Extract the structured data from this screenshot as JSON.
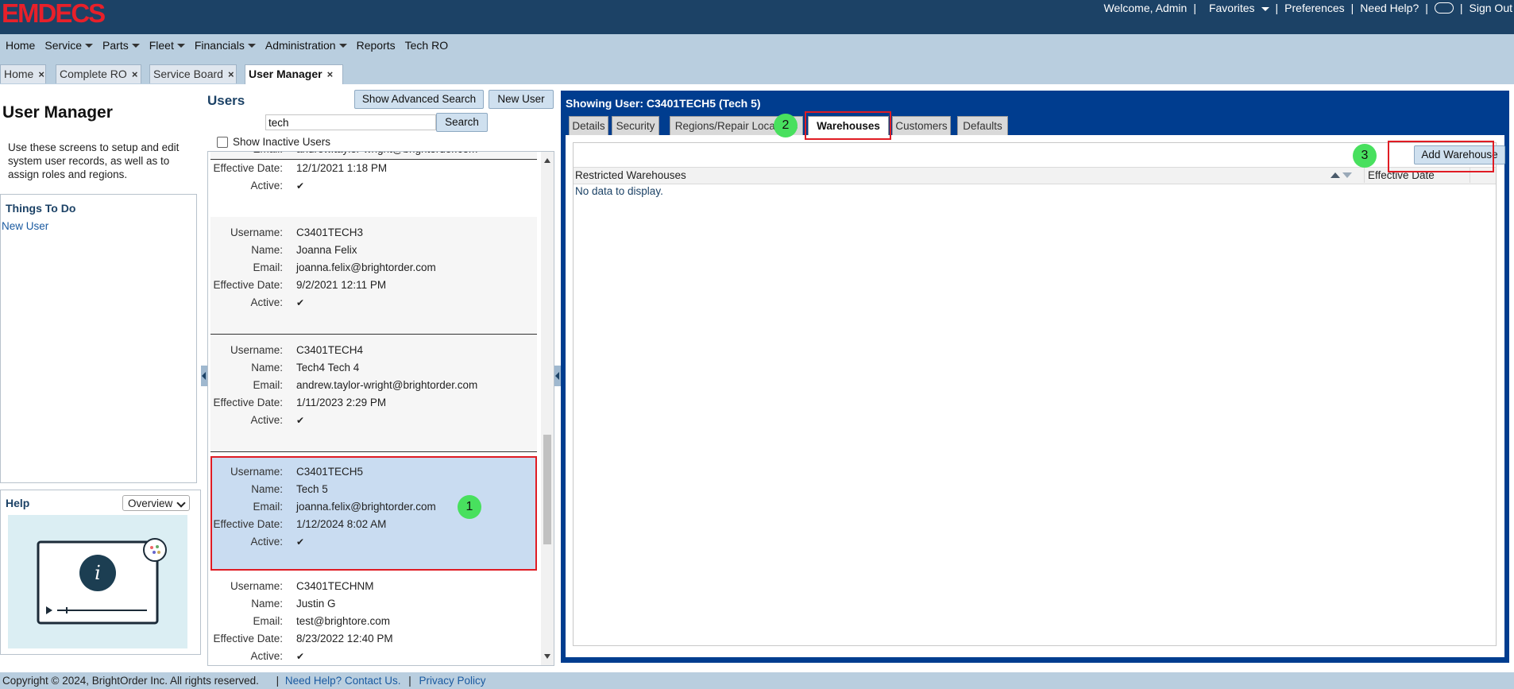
{
  "app": {
    "logo": "EMDECS"
  },
  "topbar": {
    "welcome": "Welcome, Admin",
    "favorites": "Favorites",
    "preferences": "Preferences",
    "need_help": "Need Help?",
    "sign_out": "Sign Out",
    "separator": "|"
  },
  "menu": [
    "Home",
    "Service",
    "Parts",
    "Fleet",
    "Financials",
    "Administration",
    "Reports",
    "Tech RO"
  ],
  "tabs": [
    "Home",
    "Complete RO",
    "Service Board",
    "User Manager"
  ],
  "tab_close": "×",
  "left": {
    "title": "User Manager",
    "description": "Use these screens to setup and edit system user records, as well as to assign roles and regions.",
    "todo_title": "Things To Do",
    "todo_link": "New User",
    "help_title": "Help",
    "help_select": "Overview",
    "help_info_glyph": "i"
  },
  "users": {
    "title": "Users",
    "advanced_search": "Show Advanced Search",
    "new_user": "New User",
    "search_value": "tech",
    "search_button": "Search",
    "show_inactive": "Show Inactive Users",
    "labels": {
      "username": "Username:",
      "name": "Name:",
      "email": "Email:",
      "effective_date": "Effective Date:",
      "active": "Active:"
    },
    "check_glyph": "✔",
    "partial": {
      "email": "andrew.taylor-wright@brightorder.com",
      "effective_date": "12/1/2021 1:18 PM"
    },
    "list": [
      {
        "username": "C3401TECH3",
        "name": "Joanna Felix",
        "email": "joanna.felix@brightorder.com",
        "effective_date": "9/2/2021 12:11 PM"
      },
      {
        "username": "C3401TECH4",
        "name": "Tech4 Tech 4",
        "email": "andrew.taylor-wright@brightorder.com",
        "effective_date": "1/11/2023 2:29 PM"
      },
      {
        "username": "C3401TECH5",
        "name": "Tech 5",
        "email": "joanna.felix@brightorder.com",
        "effective_date": "1/12/2024 8:02 AM",
        "selected": true
      },
      {
        "username": "C3401TECHNM",
        "name": "Justin G",
        "email": "test@brightore.com",
        "effective_date": "8/23/2022 12:40 PM"
      }
    ]
  },
  "detail": {
    "title": "Showing User: C3401TECH5 (Tech 5)",
    "tabs": [
      "Details",
      "Security",
      "Regions/Repair Locations",
      "Warehouses",
      "Customers",
      "Defaults"
    ],
    "active_tab": "Warehouses",
    "add_button": "Add Warehouse",
    "columns": [
      "Restricted Warehouses",
      "Effective Date"
    ],
    "empty_text": "No data to display."
  },
  "markers": [
    "1",
    "2",
    "3"
  ],
  "footer": {
    "copyright": "Copyright © 2024, BrightOrder Inc. All rights reserved.",
    "contact": "Need Help? Contact Us.",
    "privacy": "Privacy Policy",
    "separator": "|"
  },
  "colors": {
    "header": "#1c4266",
    "menubar": "#b9cedf",
    "detail_panel": "#003d8f",
    "highlight": "#e01c24",
    "marker": "#48e05e",
    "selected_row": "#c9dcf1"
  }
}
